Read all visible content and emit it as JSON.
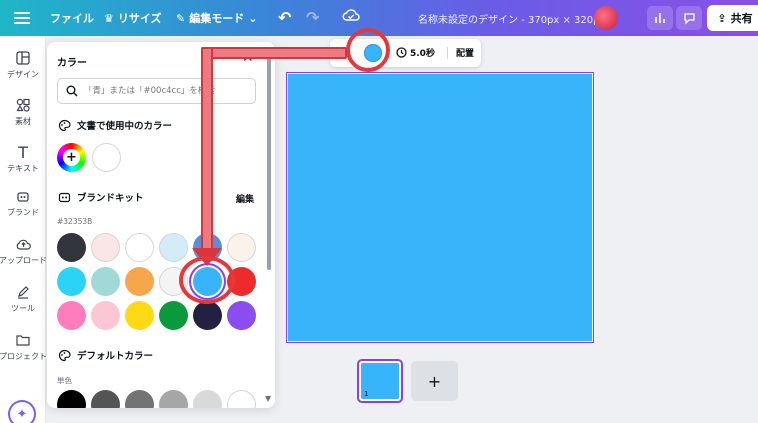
{
  "topbar": {
    "file": "ファイル",
    "resize": "リサイズ",
    "edit_mode": "編集モード",
    "title": "名称未設定のデザイン - 370px × 320px",
    "share": "共有"
  },
  "rail": [
    {
      "label": "デザイン",
      "icon": "layout-icon"
    },
    {
      "label": "素材",
      "icon": "elements-icon"
    },
    {
      "label": "テキスト",
      "icon": "text-icon"
    },
    {
      "label": "ブランド",
      "icon": "brand-icon"
    },
    {
      "label": "アップロード",
      "icon": "upload-icon"
    },
    {
      "label": "ツール",
      "icon": "draw-icon"
    },
    {
      "label": "プロジェクト",
      "icon": "folder-icon"
    }
  ],
  "panel": {
    "title": "カラー",
    "search_placeholder": "「青」または「#00c4cc」を検索",
    "doc_colors_title": "文書で使用中のカラー",
    "brand_kit_title": "ブランドキット",
    "brand_edit": "編集",
    "brand_hex": "#32353B",
    "default_colors_title": "デフォルトカラー",
    "mono_label": "単色"
  },
  "doc_colors": [
    "#ffffff"
  ],
  "brand_colors": [
    [
      "#32353b",
      "#fbe6e6",
      "#ffffff",
      "#d3ecf8",
      "#5b8ed6",
      "#fbf3e9"
    ],
    [
      "#2bd3f7",
      "#a3d8d8",
      "#f8a64b",
      "#f4f4f4",
      "#38b5fa",
      "#ee2b2b"
    ],
    [
      "#ff7cbd",
      "#fcc6d4",
      "#fed916",
      "#0a9a3c",
      "#232141",
      "#8b4cf0"
    ]
  ],
  "selected_color": "#38b5fa",
  "mono_colors": [
    "#000000",
    "#545454",
    "#737373",
    "#a6a6a6",
    "#d9d9d9",
    "#ffffff"
  ],
  "toolbar": {
    "duration": "5.0秒",
    "arrange": "配置"
  },
  "canvas": {
    "background": "#38b5fa"
  },
  "pages": {
    "current": "1",
    "add": "+"
  }
}
